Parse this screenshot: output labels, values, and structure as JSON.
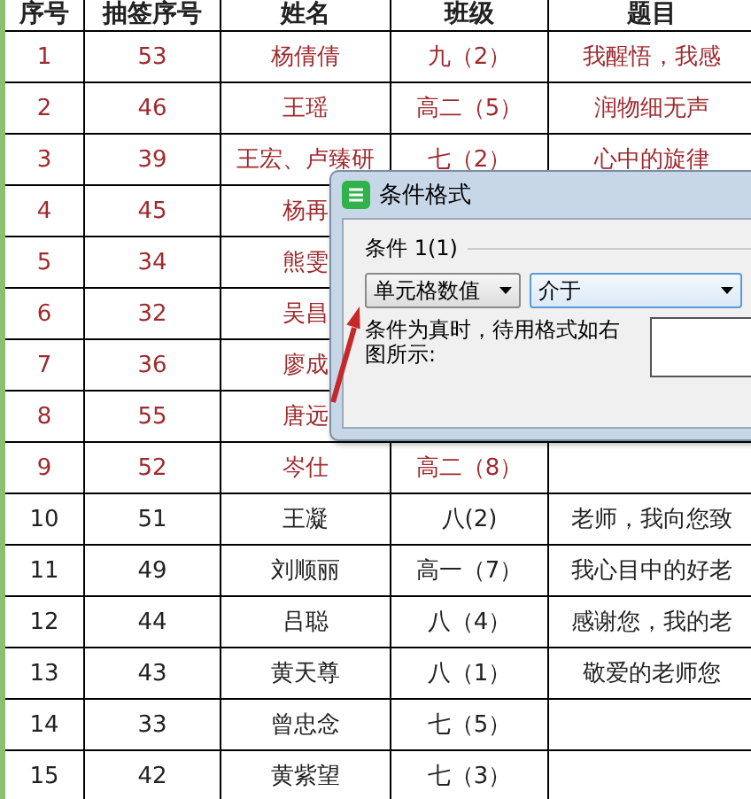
{
  "table": {
    "columns": [
      "序号",
      "抽签序号",
      "姓名",
      "班级",
      "题目"
    ],
    "rows": [
      {
        "cells": [
          "1",
          "53",
          "杨倩倩",
          "九（2）",
          "我醒悟，我感"
        ],
        "highlighted": true
      },
      {
        "cells": [
          "2",
          "46",
          "王瑶",
          "高二（5）",
          "润物细无声"
        ],
        "highlighted": true
      },
      {
        "cells": [
          "3",
          "39",
          "王宏、卢臻研",
          "七（2）",
          "心中的旋律"
        ],
        "highlighted": true
      },
      {
        "cells": [
          "4",
          "45",
          "杨再"
        ],
        "highlighted": true
      },
      {
        "cells": [
          "5",
          "34",
          "熊雯"
        ],
        "highlighted": true
      },
      {
        "cells": [
          "6",
          "32",
          "吴昌"
        ],
        "highlighted": true
      },
      {
        "cells": [
          "7",
          "36",
          "廖成"
        ],
        "highlighted": true
      },
      {
        "cells": [
          "8",
          "55",
          "唐远"
        ],
        "highlighted": true
      },
      {
        "cells": [
          "9",
          "52",
          "岑仕",
          "高二（8）"
        ],
        "highlighted": true
      },
      {
        "cells": [
          "10",
          "51",
          "王凝",
          "八(2)",
          "老师，我向您致"
        ],
        "highlighted": false
      },
      {
        "cells": [
          "11",
          "49",
          "刘顺丽",
          "高一（7）",
          "我心目中的好老"
        ],
        "highlighted": false
      },
      {
        "cells": [
          "12",
          "44",
          "吕聪",
          "八（4）",
          "感谢您，我的老"
        ],
        "highlighted": false
      },
      {
        "cells": [
          "13",
          "43",
          "黄天尊",
          "八（1）",
          "敬爱的老师您"
        ],
        "highlighted": false
      },
      {
        "cells": [
          "14",
          "33",
          "曾忠念",
          "七（5）"
        ],
        "highlighted": false
      },
      {
        "cells": [
          "15",
          "42",
          "黄紫望",
          "七（3）"
        ],
        "highlighted": false
      }
    ]
  },
  "dialog": {
    "title": "条件格式",
    "group_label": "条件 1(1)",
    "condition_type": "单元格数值",
    "operator": "介于",
    "hint": "条件为真时，待用格式如右图所示:"
  }
}
